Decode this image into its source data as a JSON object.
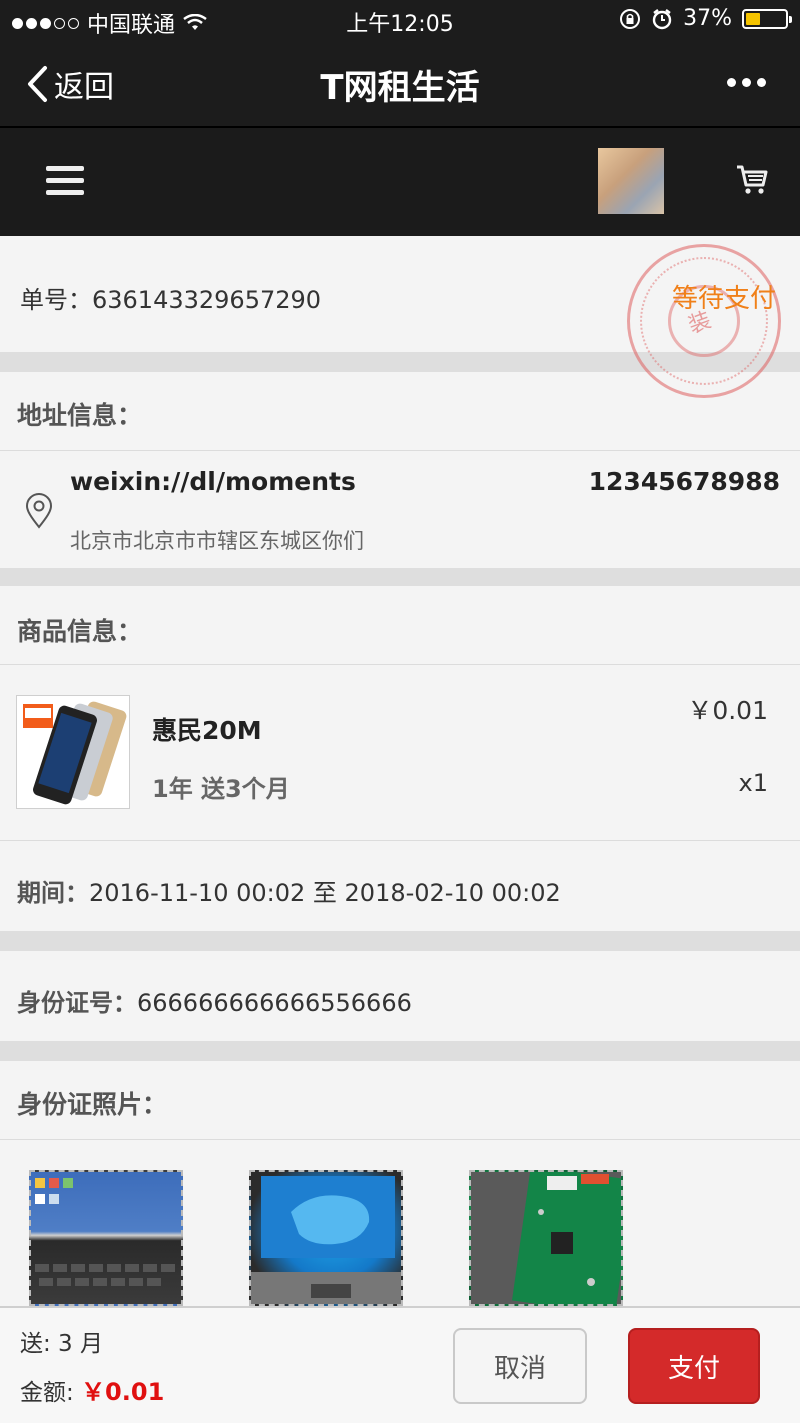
{
  "status_bar": {
    "carrier": "中国联通",
    "time": "上午12:05",
    "battery": "37%",
    "battery_level": 0.37
  },
  "nav": {
    "back_label": "返回",
    "title": "T网租生活"
  },
  "order": {
    "number_label": "单号：",
    "number": "636143329657290",
    "status": "等待支付",
    "stamp_glyph": "装"
  },
  "address": {
    "section_title": "地址信息：",
    "name": "weixin://dl/moments",
    "phone": "12345678988",
    "detail": "北京市北京市市辖区东城区你们"
  },
  "product": {
    "section_title": "商品信息：",
    "name": "惠民20M",
    "spec": "1年 送3个月",
    "price": "￥0.01",
    "quantity": "x1",
    "image_badge": "惠民200"
  },
  "period": {
    "label": "期间：",
    "value": "2016-11-10 00:02 至 2018-02-10 00:02"
  },
  "id_card": {
    "label": "身份证号：",
    "value": "666666666666556666",
    "photos_title": "身份证照片："
  },
  "footer": {
    "bonus": "送: 3 月",
    "amount_label": "金额: ",
    "amount": "￥0.01",
    "cancel_label": "取消",
    "pay_label": "支付"
  },
  "colors": {
    "status_orange": "#f08019",
    "pay_red": "#d42a2a",
    "price_red": "#e01010"
  }
}
